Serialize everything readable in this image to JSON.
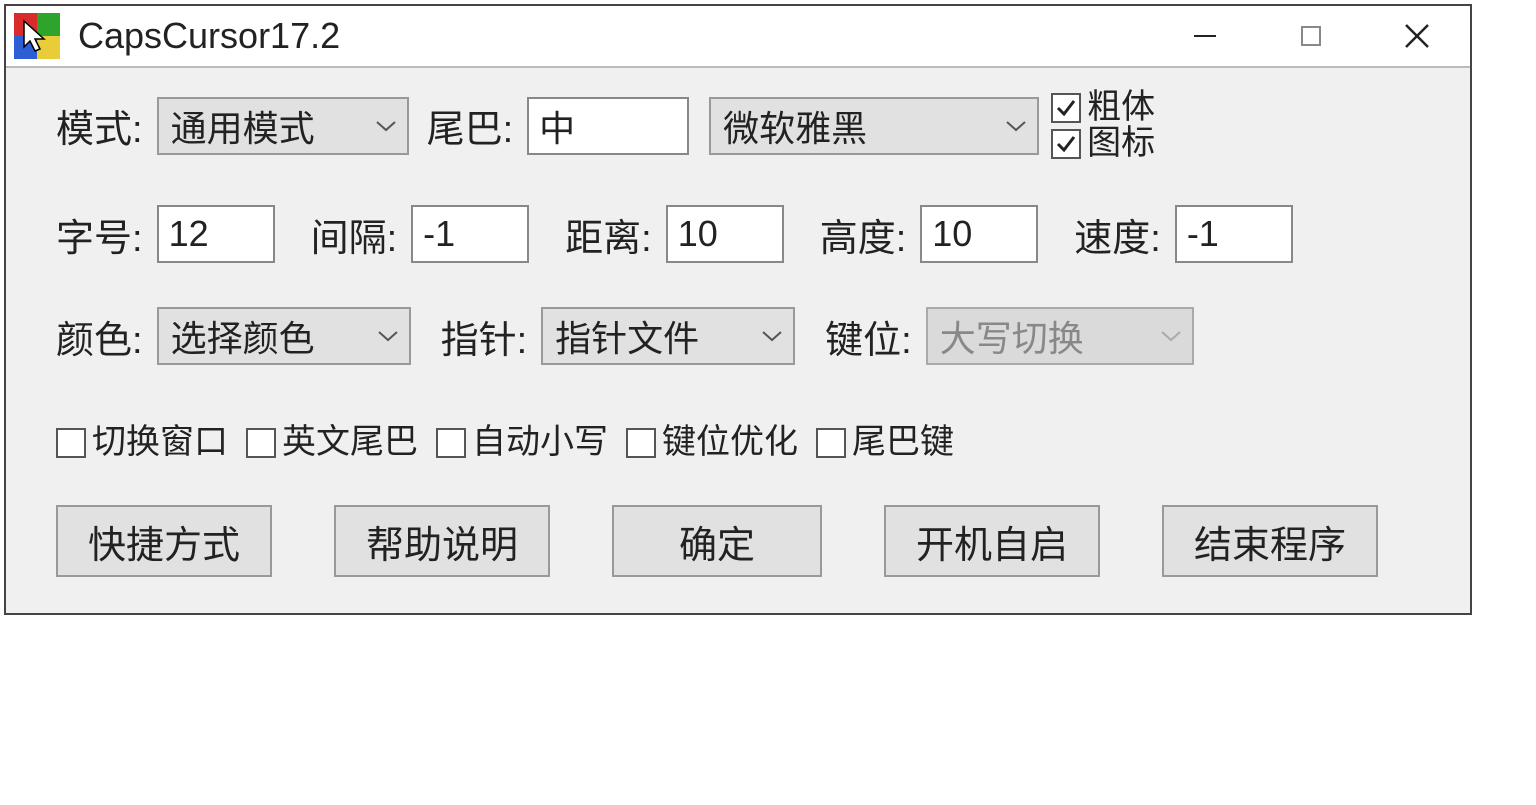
{
  "title": "CapsCursor17.2",
  "row1": {
    "mode_label": "模式:",
    "mode_value": "通用模式",
    "tail_label": "尾巴:",
    "tail_value": "中",
    "font_value": "微软雅黑",
    "bold_label": "粗体",
    "bold_checked": true,
    "icon_label": "图标",
    "icon_checked": true
  },
  "row2": {
    "fontsize_label": "字号:",
    "fontsize_value": "12",
    "interval_label": "间隔:",
    "interval_value": "-1",
    "distance_label": "距离:",
    "distance_value": "10",
    "height_label": "高度:",
    "height_value": "10",
    "speed_label": "速度:",
    "speed_value": "-1"
  },
  "row3": {
    "color_label": "颜色:",
    "color_value": "选择颜色",
    "pointer_label": "指针:",
    "pointer_value": "指针文件",
    "key_label": "键位:",
    "key_value": "大写切换"
  },
  "row4": {
    "switch_window": "切换窗口",
    "english_tail": "英文尾巴",
    "auto_lowercase": "自动小写",
    "key_optimize": "键位优化",
    "tail_key": "尾巴键"
  },
  "buttons": {
    "shortcut": "快捷方式",
    "help": "帮助说明",
    "ok": "确定",
    "autostart": "开机自启",
    "exit": "结束程序"
  }
}
